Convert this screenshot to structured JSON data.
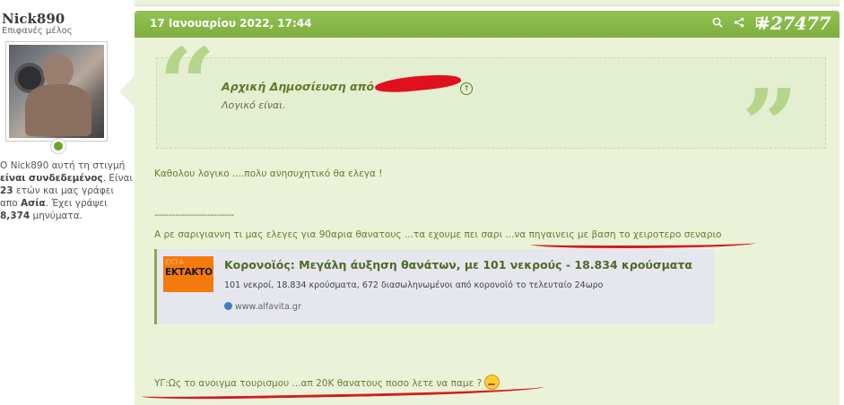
{
  "user": {
    "name": "Nick890",
    "role": "Επιφανές μέλος",
    "bio_prefix": "Ο Nick890 αυτή τη στιγμή ",
    "bio_status": "είναι συνδεδεμένος",
    "bio_mid1": ". Είναι ",
    "age": "23",
    "bio_mid2": " ετών και μας γράφει απο ",
    "location": "Ασία",
    "bio_mid3": ". Έχει γράψει ",
    "posts": "8,374",
    "bio_suffix": " μηνύματα."
  },
  "post": {
    "date": "17 Ιανουαρίου 2022, 17:44",
    "number": "#27477",
    "header_icons": [
      "search-icon",
      "share-icon",
      "bookmark-icon"
    ],
    "quote": {
      "title": "Αρχική Δημοσίευση από",
      "text": "Λογικό είναι."
    },
    "line1": "Καθολου λογικο ....πολυ ανησυχητικό θα ελεγα !",
    "separator": "---------------------------",
    "line2_text": "Α ρε σαριγιαννη τι μας ελεγες για 90αρια θανατους ...τα εχουμε πει σαρι ...",
    "line2_link": "να πηγαινεις με βαση το χειροτερο σεναριο",
    "card": {
      "thumb_label": "ΕΚΤΑΚΤΟ",
      "title": "Κορονοϊός: Μεγάλη άυξηση θανάτων, με 101 νεκρούς - 18.834 κρούσματα",
      "description": "101 νεκροί, 18.834 κρούσματα, 672 διασωληνωμένοι από κορονοϊό το τελευταίο 24ωρο",
      "source": "www.alfavita.gr"
    },
    "line3": "ΥΓ:Ως το ανοιγμα τουρισμου ...απ 20Κ θανατους ποσο λετε να παμε ?"
  },
  "colors": {
    "accent": "#7fae3f",
    "post_bg": "#eaf3d8",
    "text_green": "#5d7d24",
    "annotation_red": "#d81920"
  }
}
